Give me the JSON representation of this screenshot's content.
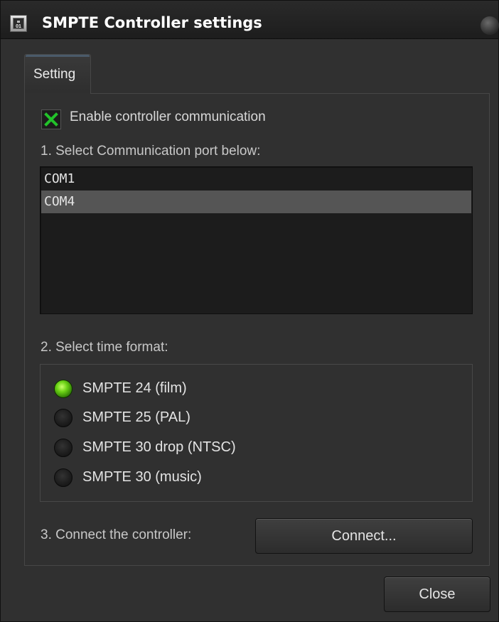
{
  "window": {
    "title": "SMPTE Controller settings",
    "icon": "clock-display-icon",
    "icon_text": "01"
  },
  "tabs": [
    {
      "label": "Setting",
      "active": true
    }
  ],
  "enable": {
    "label": "Enable controller communication",
    "checked": true,
    "icon": "x-check-icon",
    "check_color": "#22c22a"
  },
  "step1": {
    "label": "1. Select Communication port below:",
    "ports": [
      {
        "label": "COM1",
        "selected": false
      },
      {
        "label": "COM4",
        "selected": true
      }
    ]
  },
  "step2": {
    "label": "2. Select time format:",
    "options": [
      {
        "label": "SMPTE 24 (film)",
        "selected": true
      },
      {
        "label": "SMPTE 25 (PAL)",
        "selected": false
      },
      {
        "label": "SMPTE 30 drop (NTSC)",
        "selected": false
      },
      {
        "label": "SMPTE 30 (music)",
        "selected": false
      }
    ],
    "selected_color": "#6cd316"
  },
  "step3": {
    "label": "3. Connect the controller:",
    "button": "Connect..."
  },
  "footer": {
    "close_label": "Close"
  }
}
